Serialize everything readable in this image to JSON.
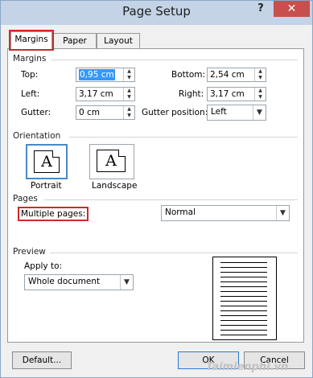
{
  "window": {
    "title": "Page Setup",
    "help": "?",
    "close": "✕"
  },
  "tabs": [
    {
      "label": "Margins"
    },
    {
      "label": "Paper"
    },
    {
      "label": "Layout"
    }
  ],
  "margins": {
    "group": "Margins",
    "top": {
      "label": "Top:",
      "value": "0,95 cm"
    },
    "bottom": {
      "label": "Bottom:",
      "value": "2,54 cm"
    },
    "left": {
      "label": "Left:",
      "value": "3,17 cm"
    },
    "right": {
      "label": "Right:",
      "value": "3,17 cm"
    },
    "gutter": {
      "label": "Gutter:",
      "value": "0 cm"
    },
    "gutter_position": {
      "label": "Gutter position:",
      "value": "Left"
    }
  },
  "orientation": {
    "group": "Orientation",
    "portrait": "Portrait",
    "landscape": "Landscape",
    "glyph": "A"
  },
  "pages": {
    "group": "Pages",
    "label": "Multiple pages:",
    "value": "Normal"
  },
  "preview": {
    "group": "Preview",
    "apply_label": "Apply to:",
    "apply_value": "Whole document"
  },
  "buttons": {
    "default": "Default...",
    "ok": "OK",
    "cancel": "Cancel"
  },
  "watermark": "Taimienphi.vn"
}
